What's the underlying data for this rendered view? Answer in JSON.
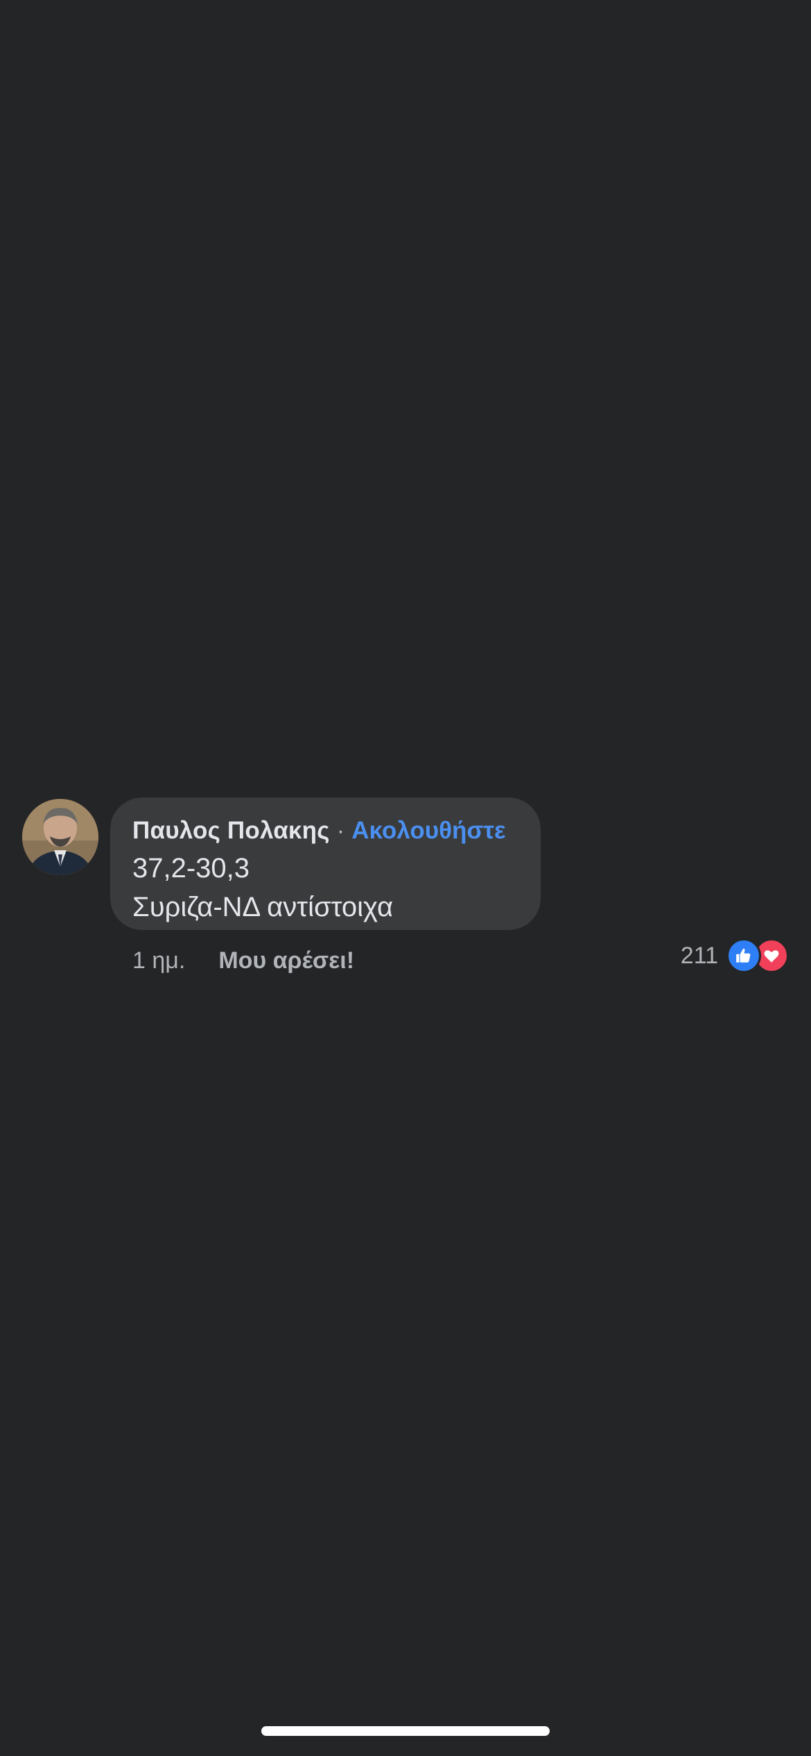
{
  "comment": {
    "author": "Παυλος Πολακης",
    "separator": "·",
    "follow_label": "Ακολουθήστε",
    "lines": [
      "37,2-30,3",
      "Συριζα-ΝΔ αντίστοιχα"
    ],
    "time": "1 ημ.",
    "like_label": "Μου αρέσει!",
    "reaction_count": "211",
    "reactions": [
      "like-icon",
      "love-icon"
    ]
  },
  "colors": {
    "background": "#242526",
    "bubble": "#3a3b3c",
    "follow_link": "#4b8ff0",
    "like_reaction": "#2e7ff5",
    "love_reaction": "#f0405a"
  }
}
